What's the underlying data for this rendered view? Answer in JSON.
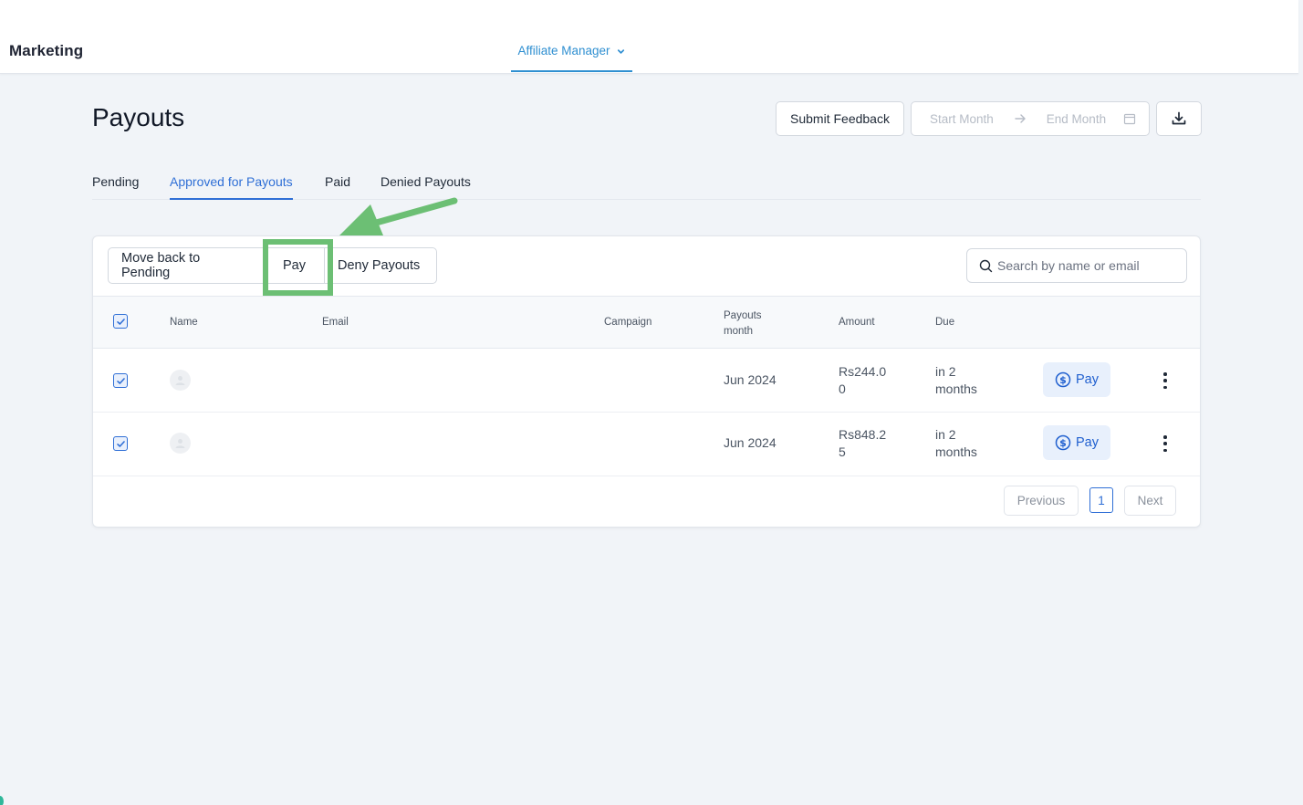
{
  "app": {
    "brand": "Marketing"
  },
  "topnav": {
    "label": "Affiliate Manager",
    "icon": "chevron-down-icon",
    "color": "#2f8fd1"
  },
  "header": {
    "title": "Payouts",
    "submit_feedback": "Submit Feedback",
    "start_month_placeholder": "Start Month",
    "end_month_placeholder": "End Month",
    "download_icon": "download-icon"
  },
  "tabs": [
    {
      "label": "Pending",
      "active": false
    },
    {
      "label": "Approved for Payouts",
      "active": true
    },
    {
      "label": "Paid",
      "active": false
    },
    {
      "label": "Denied Payouts",
      "active": false
    }
  ],
  "actions": {
    "move_back": "Move back to Pending",
    "pay": "Pay",
    "deny": "Deny Payouts"
  },
  "search": {
    "placeholder": "Search by name or email"
  },
  "table": {
    "columns": {
      "name": "Name",
      "email": "Email",
      "campaign": "Campaign",
      "payouts_month_1": "Payouts",
      "payouts_month_2": "month",
      "amount": "Amount",
      "due": "Due"
    },
    "rows": [
      {
        "checked": true,
        "name": "",
        "email": "",
        "campaign": "",
        "month": "Jun 2024",
        "amount_1": "Rs244.0",
        "amount_2": "0",
        "due_1": "in 2",
        "due_2": "months",
        "pay": "Pay"
      },
      {
        "checked": true,
        "name": "",
        "email": "",
        "campaign": "",
        "month": "Jun 2024",
        "amount_1": "Rs848.2",
        "amount_2": "5",
        "due_1": "in 2",
        "due_2": "months",
        "pay": "Pay"
      }
    ]
  },
  "pagination": {
    "previous": "Previous",
    "current": "1",
    "next": "Next"
  },
  "colors": {
    "accent": "#2f6fd6",
    "highlight": "#6cbf74",
    "pay_bg": "#e8f0fc"
  }
}
